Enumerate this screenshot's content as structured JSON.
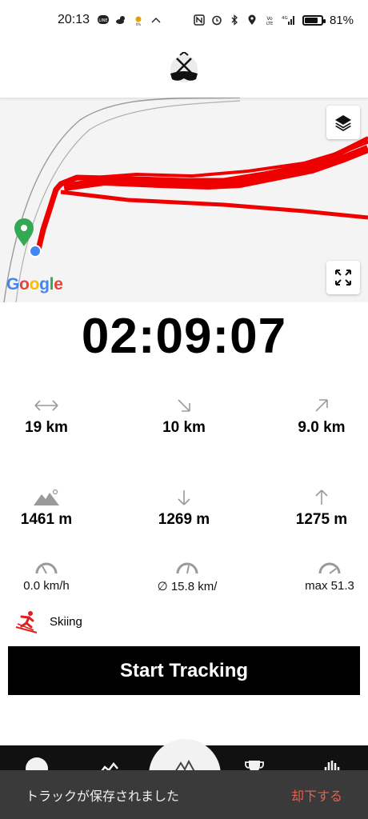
{
  "status_bar": {
    "time": "20:13",
    "battery_text": "81%",
    "battery_level": 0.81
  },
  "map": {
    "provider_logo": "Google",
    "track_color": "#ee0000",
    "start_marker_color": "#34a853",
    "position_dot_color": "#4285f4"
  },
  "timer": {
    "elapsed": "02:09:07"
  },
  "stats": {
    "distance": "19 km",
    "downhill_distance": "10 km",
    "uphill_distance": "9.0 km",
    "max_altitude": "1461 m",
    "descent": "1269 m",
    "ascent": "1275 m",
    "current_speed": "0.0 km/h",
    "avg_speed": "∅ 15.8 km/",
    "max_speed": "max 51.3"
  },
  "activity": {
    "sport": "Skiing",
    "icon": "skier-icon"
  },
  "actions": {
    "start_tracking": "Start Tracking"
  },
  "snackbar": {
    "message": "トラックが保存されました",
    "action": "却下する"
  }
}
